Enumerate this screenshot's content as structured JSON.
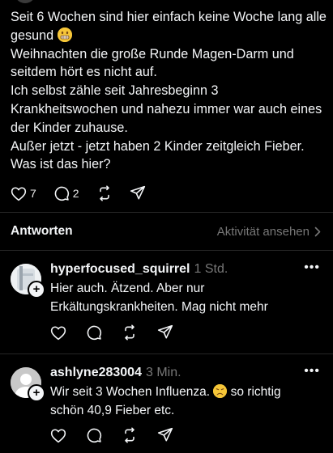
{
  "post": {
    "lines": [
      "Seit 6 Wochen sind hier einfach keine Woche lang alle",
      "gesund",
      "Weihnachten die große Runde Magen-Darm und",
      "seitdem hört es nicht auf.",
      "Ich selbst zähle seit Jahresbeginn 3",
      "Krankheitswochen und nahezu immer war auch eines",
      "der Kinder zuhause.",
      "Außer jetzt - jetzt haben 2 Kinder zeitgleich Fieber.",
      "Was ist das hier?"
    ],
    "emoji_after_line_2": "grimacing-face",
    "like_count": "7",
    "comment_count": "2",
    "icons": [
      "heart-icon",
      "comment-icon",
      "repost-icon",
      "share-icon"
    ]
  },
  "replies_header": {
    "title": "Antworten",
    "activity_link": "Aktivität ansehen"
  },
  "replies": [
    {
      "username": "hyperfocused_squirrel",
      "time": "1 Std.",
      "lines": [
        "Hier auch. Ätzend. Aber nur",
        "Erkältungskrankheiten. Mag nicht mehr"
      ],
      "more": "•••"
    },
    {
      "username": "ashlyne283004",
      "time": "3 Min.",
      "lines": [
        "Wir seit 3 Wochen Influenza.",
        "so richtig",
        "schön 40,9 Fieber etc."
      ],
      "emoji": "persevering-face",
      "more": "•••"
    }
  ],
  "colors": {
    "background": "#000000",
    "text": "#f3f5f7",
    "muted": "#777777",
    "divider": "#262626"
  }
}
